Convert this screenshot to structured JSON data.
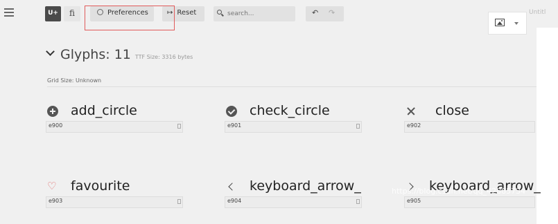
{
  "toolbar": {
    "u_label": "U+",
    "fi_label": "fi",
    "preferences_label": "Preferences",
    "reset_label": "Reset",
    "search_placeholder": "search...",
    "untitled": "Untitl"
  },
  "section": {
    "title": "Glyphs: 11",
    "subtitle": "TTF Size: 3316 bytes",
    "grid_size": "Grid Size: Unknown"
  },
  "glyphs": [
    {
      "name": "add_circle",
      "code": "e900",
      "icon": "add-circle-icon"
    },
    {
      "name": "check_circle",
      "code": "e901",
      "icon": "check-circle-icon"
    },
    {
      "name": "close",
      "code": "e902",
      "icon": "close-icon"
    },
    {
      "name": "favourite",
      "code": "e903",
      "icon": "heart-icon"
    },
    {
      "name": "keyboard_arrow_",
      "code": "e904",
      "icon": "arrow-left-icon"
    },
    {
      "name": "keyboard_arrow_",
      "code": "e905",
      "icon": "arrow-right-icon"
    }
  ],
  "watermark": "https://blog.csdn.net/qq_42885734",
  "colors": {
    "accent": "#e06b6b",
    "toolbar_bg": "#f0f0f0",
    "highlight": "#e05a5a"
  }
}
